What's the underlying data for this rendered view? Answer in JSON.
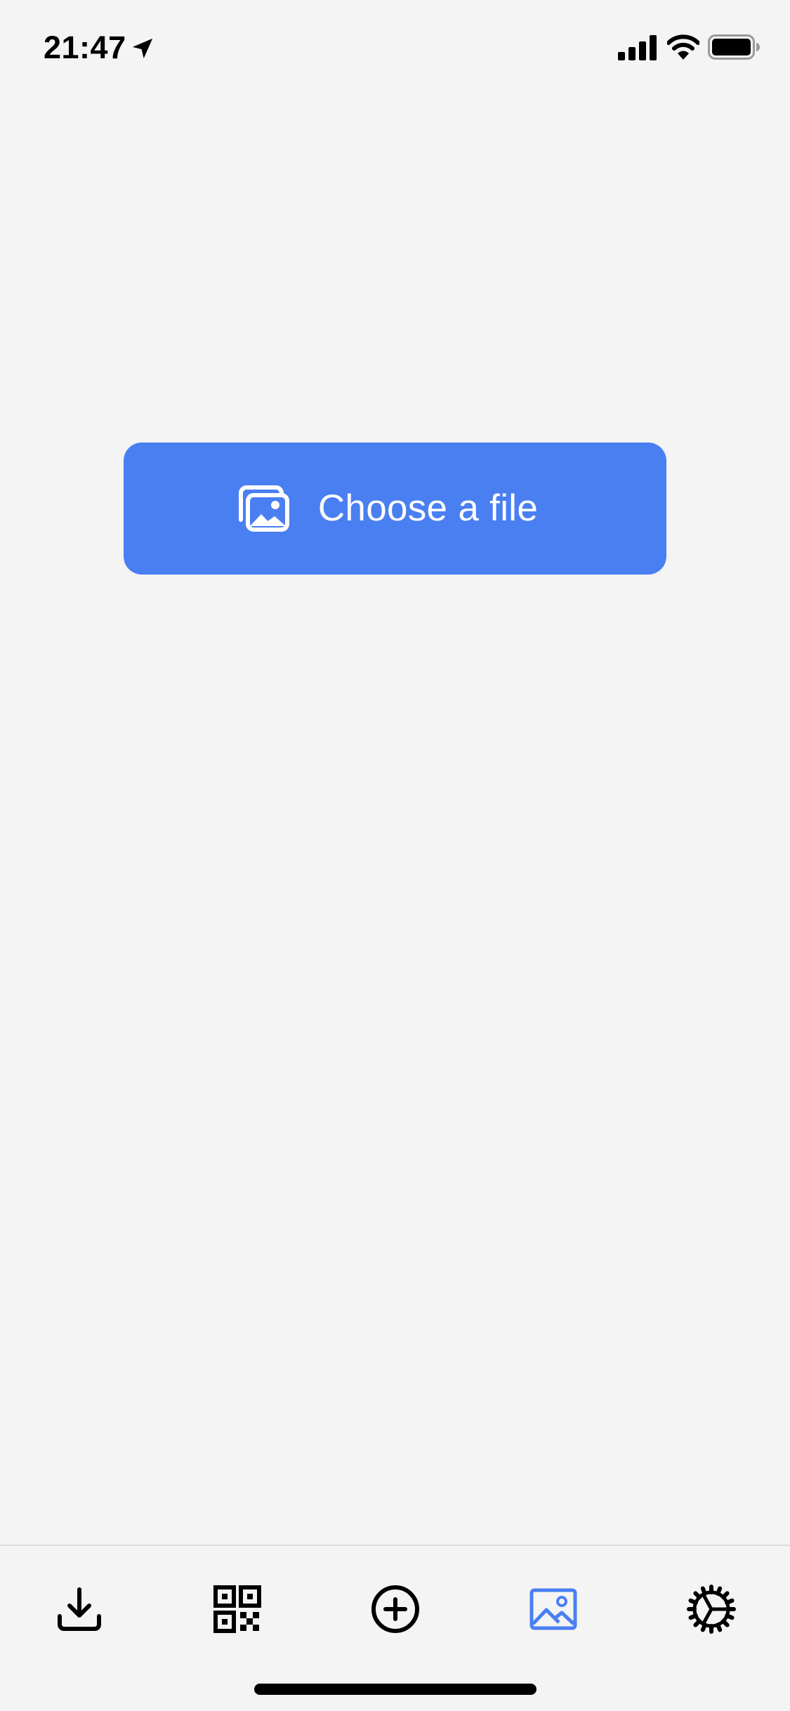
{
  "status_bar": {
    "time": "21:47",
    "icons": [
      "location-arrow-icon",
      "cellular-signal-icon",
      "wifi-icon",
      "battery-icon"
    ]
  },
  "main": {
    "choose_file_button": {
      "label": "Choose a file",
      "icon": "photo-stack-icon",
      "background_color": "#4a7ff2"
    }
  },
  "tab_bar": {
    "active_color": "#4a7ff2",
    "tabs": [
      {
        "icon": "download-icon",
        "active": false
      },
      {
        "icon": "qr-code-icon",
        "active": false
      },
      {
        "icon": "plus-circle-icon",
        "active": false
      },
      {
        "icon": "image-icon",
        "active": true
      },
      {
        "icon": "gear-icon",
        "active": false
      }
    ]
  }
}
